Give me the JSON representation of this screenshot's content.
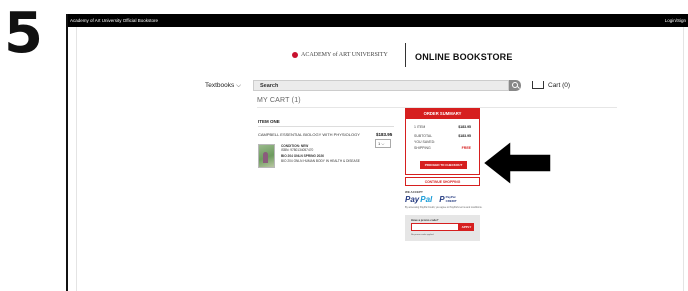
{
  "step_number": "5",
  "topbar": {
    "left_text": "Academy of Art University Official Bookstore",
    "right_text": "Login/Sign"
  },
  "header": {
    "logo_text": "ACADEMY of ART UNIVERSITY",
    "store_title": "ONLINE BOOKSTORE"
  },
  "search": {
    "category_label": "Textbooks ⌵",
    "placeholder": "Search",
    "cart_label": "Cart (0)"
  },
  "cart": {
    "title": "MY CART (1)",
    "item_heading": "ITEM ONE",
    "item": {
      "title": "CAMPBELL ESSENTIAL BIOLOGY WITH PHYSIOLOGY",
      "price": "$183.95",
      "qty": "1",
      "condition": "CONDITION: NEW",
      "isbn": "ISBN: 9780134057470",
      "course_line1": "BIO 204 ONLN  SPRING 2026",
      "course_line2": "BIO 204 ONLN HUMAN BODY IN HEALTH & DISEASE"
    }
  },
  "summary": {
    "heading": "ORDER SUMMARY",
    "items_label": "1 ITEM",
    "items_value": "$183.95",
    "subtotal_label": "SUBTOTAL",
    "subtotal_value": "$183.95",
    "saved_label": "YOU SAVED:",
    "shipping_label": "SHIPPING",
    "shipping_value": "FREE",
    "proceed_label": "PROCEED TO CHECKOUT"
  },
  "continue_label": "CONTINUE SHOPPING",
  "payments": {
    "we_accept": "WE ACCEPT",
    "paypal_a": "Pay",
    "paypal_b": "Pal",
    "credit_p": "P",
    "credit_l1": "PayPal",
    "credit_l2": "CREDIT",
    "note": "By accessing PayPal Credit, you agree to PayPal's terms and conditions."
  },
  "promo": {
    "question": "Have a promo code?",
    "apply_label": "APPLY",
    "note": "No promo code applied"
  },
  "colors": {
    "accent": "#d61f1f",
    "topbar": "#000000"
  }
}
